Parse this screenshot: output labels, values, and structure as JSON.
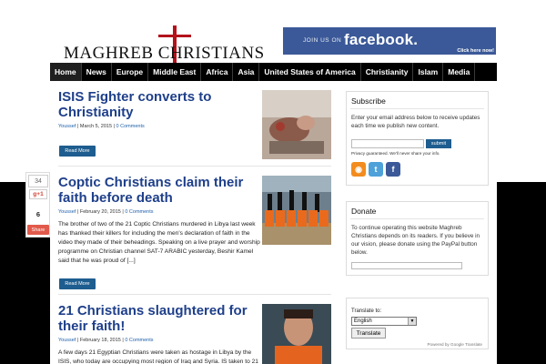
{
  "site": {
    "logo_text": "MAGHREB CHRISTIANS",
    "fb_banner": {
      "join": "JOIN US ON",
      "brand": "facebook.",
      "click": "Click here now!"
    }
  },
  "nav": {
    "items": [
      "Home",
      "News",
      "Europe",
      "Middle East",
      "Africa",
      "Asia",
      "United States of America",
      "Christianity",
      "Islam",
      "Media"
    ]
  },
  "articles": [
    {
      "title": "ISIS Fighter converts to Christianity",
      "author": "Youssef",
      "date": "March 5, 2015",
      "comments": "0 Comments",
      "excerpt": "",
      "read_more": "Read More"
    },
    {
      "title": "Coptic Christians claim their faith before death",
      "author": "Youssef",
      "date": "February 20, 2015",
      "comments": "0 Comments",
      "excerpt": "The brother of two of the 21 Coptic Christians murdered in Libya last week has thanked their killers for including the men's declaration of faith in the video they made of their beheadings. Speaking on a live prayer and worship programme on Christian channel SAT-7 ARABIC yesterday, Beshir Kamel said that he was proud of [...]",
      "read_more": "Read More"
    },
    {
      "title": "21 Christians slaughtered for their faith!",
      "author": "Youssef",
      "date": "February 18, 2015",
      "comments": "0 Comments",
      "excerpt": "A few days 21 Egyptian Christians were taken as hostage in Libya by the ISIS, who today are occupying most region of Iraq and Syria. IS taken to 21"
    }
  ],
  "share": {
    "count_top": "34",
    "gplus": "g+1",
    "total": "6",
    "share_label": "Share"
  },
  "subscribe": {
    "title": "Subscribe",
    "text": "Enter your email address below to receive updates each time we publish new content.",
    "placeholder": "",
    "button": "submit",
    "privacy": "Privacy guaranteed. We'll never share your info."
  },
  "donate": {
    "title": "Donate",
    "text": "To continue operating this website Maghreb Christians depends on its readers. If you believe in our vision, please donate using the PayPal button below."
  },
  "translate": {
    "label": "Translate to:",
    "selected": "English",
    "button": "Translate",
    "powered": "Powered by Google Translate"
  },
  "colors": {
    "title_blue": "#1e3f8a",
    "button_blue": "#1e5d8f",
    "facebook": "#3b5998"
  }
}
